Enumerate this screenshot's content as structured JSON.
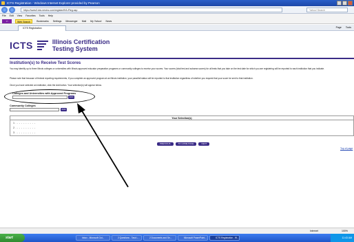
{
  "browser": {
    "title": "ICTS Registration - Windows Internet Explorer provided by Pearson",
    "url": "https://www3.icts.nesinc.com/register/ilVL/Reg.asp",
    "search_placeholder": "Yahoo! Search",
    "menu": [
      "File",
      "Edit",
      "View",
      "Favorites",
      "Tools",
      "Help"
    ],
    "toolbar": {
      "yahoo_label": "Y!",
      "web_search": "Web Search",
      "bookmarks": "Bookmarks",
      "settings": "Settings",
      "messenger": "Messenger",
      "mail": "Mail",
      "my_yahoo": "My Yahoo!",
      "news": "News"
    },
    "tab_label": "ICTS Registration",
    "tools": [
      "Page",
      "Tools"
    ]
  },
  "page": {
    "logo_text": "ICTS",
    "system_title_line1": "Illinois Certification",
    "system_title_line2": "Testing System",
    "section_heading": "Institution(s) to Receive Test Scores",
    "para1": "You may identify up to three Illinois colleges or universities with Illinois-approved educator preparation programs or community colleges to receive your scores. Your scores (total test and subarea scores) for all tests that you take on the test date for which you are registering will be reported to each institution that you indicate.",
    "para2": "Please note that because of federal reporting requirements, if you complete an approved program at an Illinois institution, your pass/fail status will be reported to that institution regardless of whether you request that your score be sent to that institution.",
    "para3": "Once you have selected an institution, click the Add button. Your selection(s) will appear below.",
    "colleges_label": "Colleges and Universities with Approved Programs",
    "community_label": "Community Colleges",
    "add_label": "ADD",
    "selections_header": "Your Selection(s)",
    "rows": [
      "1. - - - - - - - - -",
      "2. - - - - - - - - -",
      "3. - - - - - - - - -"
    ],
    "btn_previous": "PREVIOUS",
    "btn_home": "TO HOME PAGE",
    "btn_next": "NEXT",
    "top_link": "Top of page"
  },
  "status": {
    "zone": "Internet",
    "zoom": "100%"
  },
  "taskbar": {
    "start": "start",
    "tasks": [
      "Inbox - Microsoft Out...",
      "2 Questions - Task L...",
      "2 Documents and Se...",
      "Microsoft PowerPoint...",
      "ICTS Registration - W..."
    ],
    "clock": "11:43 AM"
  }
}
